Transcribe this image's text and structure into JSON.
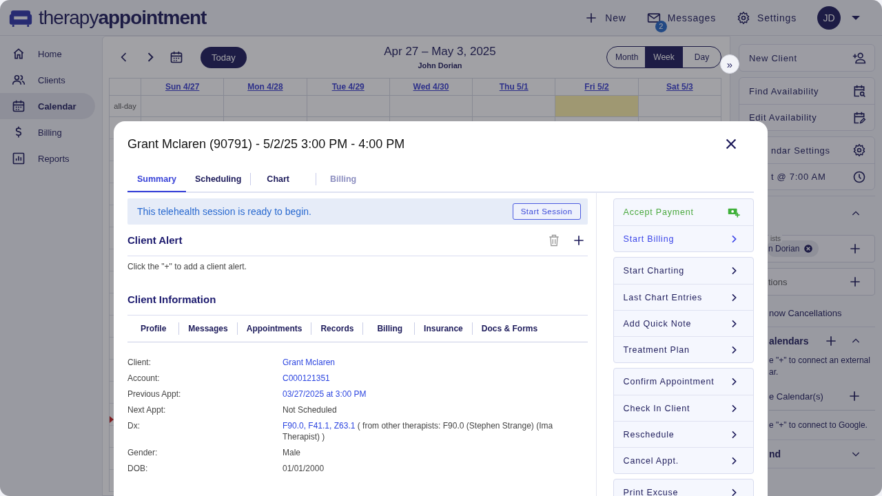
{
  "header": {
    "logo": "therapy**appointment**",
    "actions": [
      {
        "kind": "new",
        "label": "New"
      },
      {
        "kind": "messages",
        "label": "Messages",
        "badge": "2"
      },
      {
        "kind": "settings",
        "label": "Settings"
      }
    ],
    "avatar": "JD"
  },
  "sidebar": {
    "items": [
      {
        "label": "Home",
        "selected": false
      },
      {
        "label": "Clients",
        "selected": false
      },
      {
        "label": "Calendar",
        "selected": true
      },
      {
        "label": "Billing",
        "selected": false
      },
      {
        "label": "Reports",
        "selected": false
      }
    ]
  },
  "calendar": {
    "title": "Apr 27 – May 3, 2025",
    "subtitle": "John Dorian",
    "today_button": "Today",
    "collapse": "»",
    "allday_label": "all-day",
    "views": [
      {
        "label": "Month",
        "selected": false
      },
      {
        "label": "Week",
        "selected": true
      },
      {
        "label": "Day",
        "selected": false
      }
    ],
    "days": [
      {
        "label": "Sun 4/27",
        "today": false
      },
      {
        "label": "Mon 4/28",
        "today": false
      },
      {
        "label": "Tue 4/29",
        "today": false
      },
      {
        "label": "Wed 4/30",
        "today": false
      },
      {
        "label": "Thu 5/1",
        "today": false
      },
      {
        "label": "Fri 5/2",
        "today": true
      },
      {
        "label": "Sat 5/3",
        "today": false
      }
    ]
  },
  "right_panel": {
    "groups": [
      [
        {
          "label": "New Client"
        }
      ],
      [
        {
          "label": "Find Availability"
        },
        {
          "label": "Edit Availability"
        }
      ],
      [
        {
          "label": "ndar Settings"
        },
        {
          "label": "t @ 7:00 AM"
        }
      ]
    ],
    "filters": {
      "expanded": true,
      "therapists_legend": "ists",
      "chip": "n Dorian",
      "locations": "tions",
      "show_cancellations": "now Cancellations"
    },
    "external": {
      "title": "alendars",
      "expanded": true,
      "hint_lines": [
        "e \"+\" to connect an external",
        "ar."
      ],
      "google_label": "e Calendar(s)",
      "google_hint": "e \"+\" to connect to Google."
    },
    "legend": {
      "title": "nd",
      "expanded": false
    }
  },
  "modal": {
    "title": "Grant Mclaren (90791) - 5/2/25 3:00 PM - 4:00 PM",
    "tabs": [
      {
        "label": "Summary",
        "selected": true,
        "disabled": false
      },
      {
        "label": "Scheduling",
        "selected": false,
        "disabled": false
      },
      {
        "label": "Chart",
        "selected": false,
        "disabled": false
      },
      {
        "label": "Billing",
        "selected": false,
        "disabled": true
      }
    ],
    "banner": {
      "text": "This telehealth session is ready to begin.",
      "button": "Start Session"
    },
    "alert": {
      "title": "Client Alert",
      "hint": "Click the \"+\" to add a client alert."
    },
    "info": {
      "title": "Client Information",
      "tabs": [
        "Profile",
        "Messages",
        "Appointments",
        "Records",
        "Billing",
        "Insurance",
        "Docs & Forms"
      ],
      "fields": [
        {
          "label": "Client:",
          "kind": "link",
          "value": "Grant Mclaren"
        },
        {
          "label": "Account:",
          "kind": "link",
          "value": "C000121351"
        },
        {
          "label": "Previous Appt:",
          "kind": "link",
          "value": "03/27/2025 at 3:00 PM"
        },
        {
          "label": "Next Appt:",
          "kind": "text",
          "value": "Not Scheduled"
        },
        {
          "label": "Dx:",
          "kind": "dx",
          "value": "F90.0, F41.1, Z63.1",
          "note": " ( from other therapists: F90.0 (Stephen Strange) (Ima Therapist) )"
        },
        {
          "label": "Gender:",
          "kind": "text",
          "value": "Male"
        },
        {
          "label": "DOB:",
          "kind": "text",
          "value": "01/01/2000"
        }
      ]
    },
    "action_groups": [
      [
        {
          "label": "Accept Payment",
          "kind": "payment"
        },
        {
          "label": "Start Billing",
          "kind": "primary"
        }
      ],
      [
        {
          "label": "Start Charting",
          "kind": "default"
        },
        {
          "label": "Last Chart Entries",
          "kind": "default"
        },
        {
          "label": "Add Quick Note",
          "kind": "default"
        },
        {
          "label": "Treatment Plan",
          "kind": "default"
        }
      ],
      [
        {
          "label": "Confirm Appointment",
          "kind": "default"
        },
        {
          "label": "Check In Client",
          "kind": "default"
        },
        {
          "label": "Reschedule",
          "kind": "default"
        },
        {
          "label": "Cancel Appt.",
          "kind": "default"
        }
      ],
      [
        {
          "label": "Print Excuse",
          "kind": "default"
        }
      ]
    ]
  }
}
